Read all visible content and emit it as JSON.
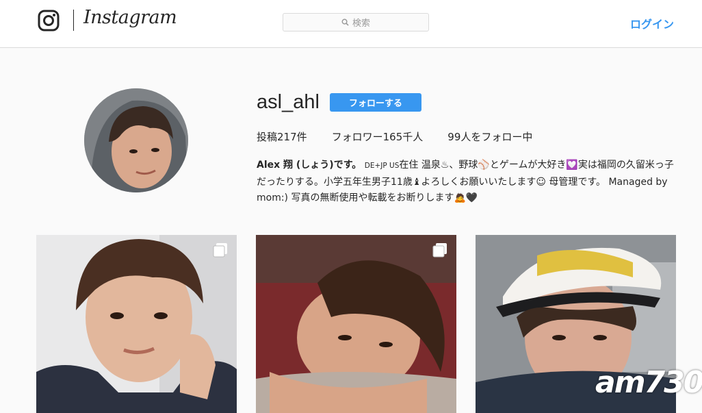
{
  "header": {
    "brand": "Instagram",
    "search_placeholder": "検索",
    "login_label": "ログイン"
  },
  "profile": {
    "username": "asl_ahl",
    "follow_label": "フォローする",
    "stats": {
      "posts": "投稿217件",
      "followers": "フォロワー165千人",
      "following": "99人をフォロー中"
    },
    "bio": {
      "name": "Alex 翔 (しょう)です。",
      "tag": "DE+JP US",
      "text": "在住 温泉♨、野球⚾とゲームが大好き💟実は福岡の久留米っ子だったりする。小学五年生男子11歳♝よろしくお願いいたします☺ 母管理です。 Managed by mom:) 写真の無断使用や転載をお断りします🙇🖤"
    }
  },
  "watermark": "am730",
  "colors": {
    "accent": "#3897f0",
    "border": "#dbdbdb",
    "background": "#fafafa"
  },
  "icons": [
    "instagram-glyph-icon",
    "search-icon",
    "multiple-photos-icon"
  ]
}
